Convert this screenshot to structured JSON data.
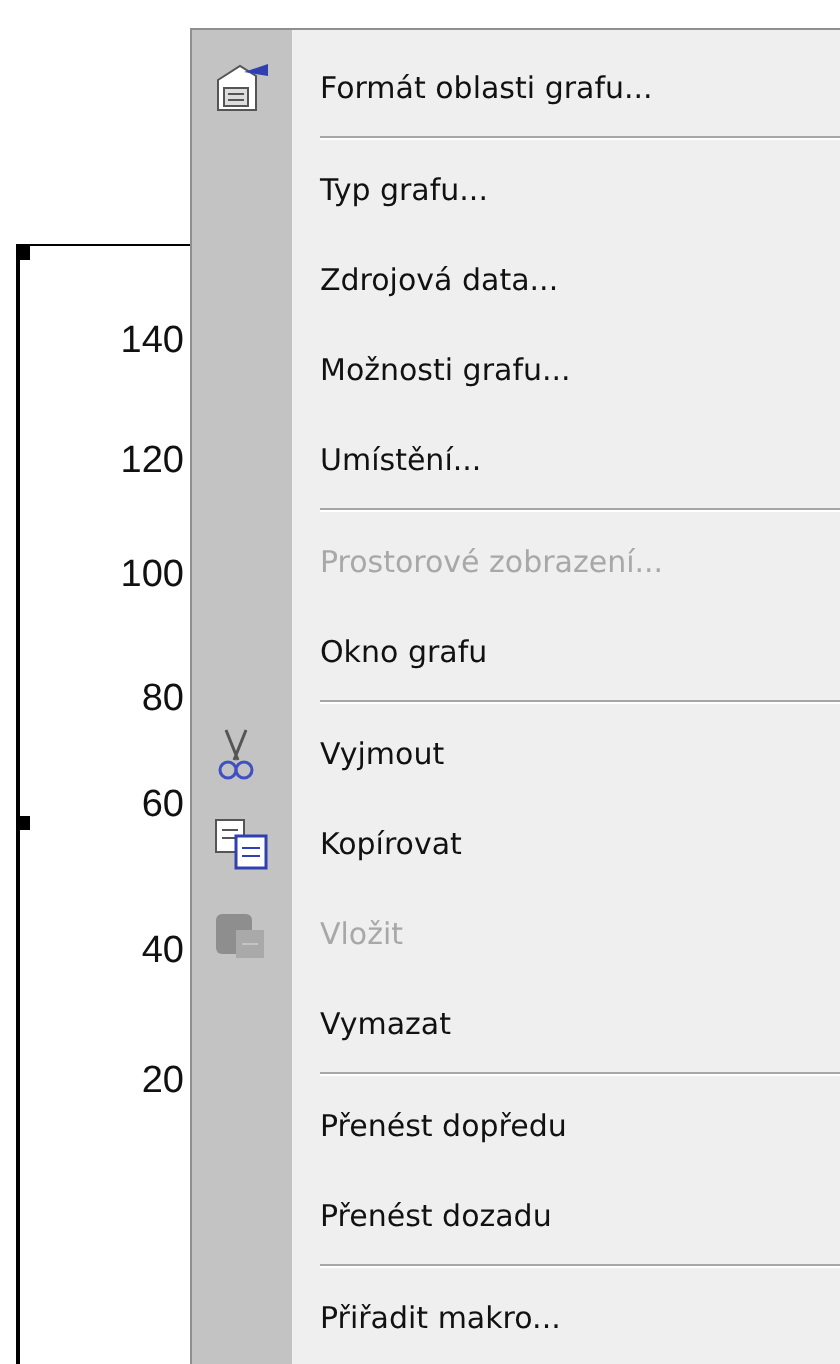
{
  "chart": {
    "y_axis_labels": [
      "140",
      "120",
      "100",
      "80",
      "60",
      "40",
      "20"
    ]
  },
  "context_menu": {
    "items": [
      {
        "kind": "icon_command",
        "label": "Formát oblasti grafu...",
        "disabled": false
      },
      {
        "kind": "separator"
      },
      {
        "kind": "command",
        "label": "Typ grafu...",
        "disabled": false
      },
      {
        "kind": "command",
        "label": "Zdrojová data...",
        "disabled": false
      },
      {
        "kind": "command",
        "label": "Možnosti grafu...",
        "disabled": false
      },
      {
        "kind": "command",
        "label": "Umístění...",
        "disabled": false
      },
      {
        "kind": "separator"
      },
      {
        "kind": "command",
        "label": "Prostorové zobrazení...",
        "disabled": true
      },
      {
        "kind": "command",
        "label": "Okno grafu",
        "disabled": false
      },
      {
        "kind": "separator"
      },
      {
        "kind": "icon_command",
        "label": "Vyjmout",
        "disabled": false
      },
      {
        "kind": "icon_command",
        "label": "Kopírovat",
        "disabled": false
      },
      {
        "kind": "icon_command",
        "label": "Vložit",
        "disabled": true
      },
      {
        "kind": "command",
        "label": "Vymazat",
        "disabled": false
      },
      {
        "kind": "separator"
      },
      {
        "kind": "command",
        "label": "Přenést dopředu",
        "disabled": false
      },
      {
        "kind": "command",
        "label": "Přenést dozadu",
        "disabled": false
      },
      {
        "kind": "separator"
      },
      {
        "kind": "command",
        "label": "Přiřadit makro...",
        "disabled": false
      }
    ]
  }
}
